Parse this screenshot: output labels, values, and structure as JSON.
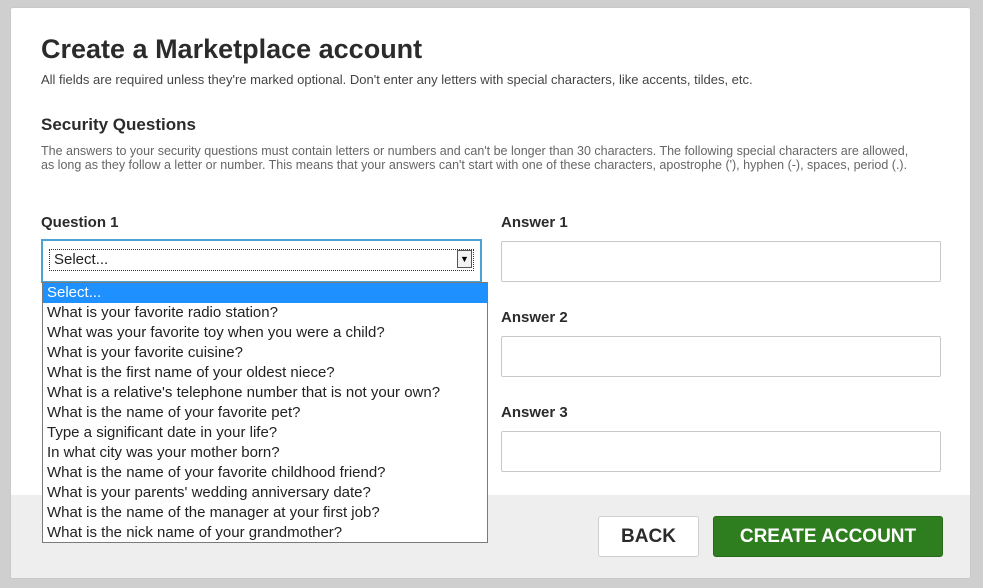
{
  "header": {
    "title": "Create a Marketplace account",
    "intro": "All fields are required unless they're marked optional. Don't enter any letters with special characters, like accents, tildes, etc."
  },
  "security": {
    "title": "Security Questions",
    "description": "The answers to your security questions must contain letters or numbers and can't be longer than 30 characters. The following special characters are allowed, as long as they follow a letter or number. This means that your answers can't start with one of these characters, apostrophe ('), hyphen (-), spaces, period (.)."
  },
  "form": {
    "question1_label": "Question 1",
    "question1_value": "Select...",
    "answer1_label": "Answer 1",
    "answer2_label": "Answer 2",
    "answer3_label": "Answer 3"
  },
  "dropdown": {
    "options": [
      "Select...",
      "What is your favorite radio station?",
      "What was your favorite toy when you were a child?",
      "What is your favorite cuisine?",
      "What is the first name of your oldest niece?",
      "What is a relative's telephone number that is not your own?",
      "What is the name of your favorite pet?",
      "Type a significant date in your life?",
      "In what city was your mother born?",
      "What is the name of your favorite childhood friend?",
      "What is your parents' wedding anniversary date?",
      "What is the name of the manager at your first job?",
      "What is the nick name of your grandmother?"
    ],
    "selected_index": 0
  },
  "actions": {
    "back_label": "BACK",
    "create_label": "CREATE ACCOUNT"
  },
  "colors": {
    "focus_border": "#4aa3d2",
    "primary_button": "#2e7d1e",
    "selected_option": "#1e90ff"
  }
}
